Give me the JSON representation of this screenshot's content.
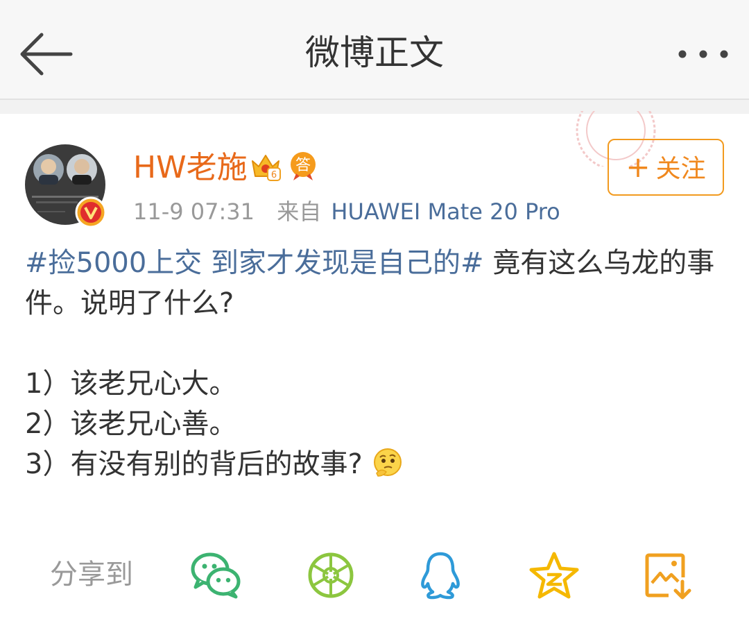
{
  "header": {
    "title": "微博正文",
    "back_icon": "arrow-left-icon",
    "more_icon": "more-horizontal-icon"
  },
  "post": {
    "author": {
      "name": "HW老施",
      "verified_badge": "V",
      "level_badge": "6",
      "answer_badge": "答"
    },
    "time": "11-9 07:31",
    "source_prefix": "来自",
    "source_device": "HUAWEI Mate 20 Pro",
    "follow_label": "关注",
    "topic": "#捡5000上交 到家才发现是自己的#",
    "text_after_topic": " 竟有这么乌龙的事件。说明了什么?",
    "list": [
      "1）该老兄心大。",
      "2）该老兄心善。",
      "3）有没有别的背后的故事?"
    ],
    "emoji": "thinking-face-emoji"
  },
  "share": {
    "label": "分享到",
    "targets": [
      "wechat-icon",
      "moments-icon",
      "qq-icon",
      "qzone-icon",
      "save-image-icon"
    ]
  },
  "colors": {
    "username": "#e8691a",
    "link": "#4a6d9a",
    "follow": "#f29a1e",
    "wechat": "#3cb371",
    "moments": "#8cc63f",
    "qq": "#2e9ad8",
    "qzone": "#f5b800",
    "save": "#f0a020"
  }
}
